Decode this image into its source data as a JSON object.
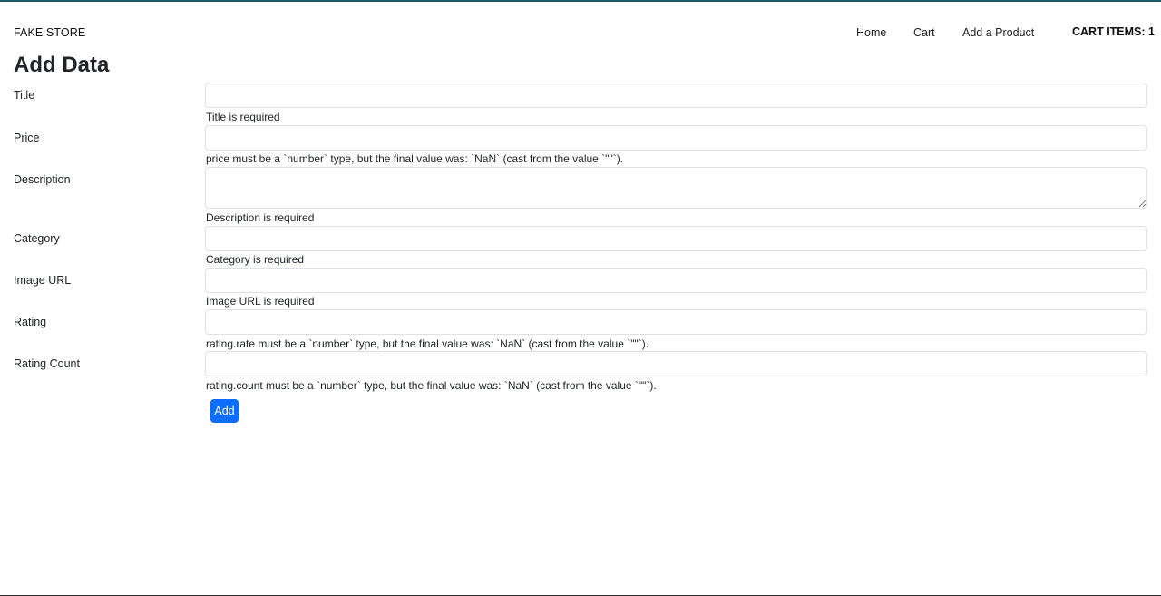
{
  "navbar": {
    "brand": "FAKE STORE",
    "links": [
      "Home",
      "Cart",
      "Add a Product"
    ],
    "cart_items": "CART ITEMS: 1"
  },
  "page": {
    "title": "Add Data"
  },
  "form": {
    "fields": [
      {
        "label": "Title",
        "value": "",
        "error": "Title is required"
      },
      {
        "label": "Price",
        "value": "",
        "error": "price must be a `number` type, but the final value was: `NaN` (cast from the value `\"\"`)."
      },
      {
        "label": "Description",
        "value": "",
        "error": "Description is required"
      },
      {
        "label": "Category",
        "value": "",
        "error": "Category is required"
      },
      {
        "label": "Image URL",
        "value": "",
        "error": "Image URL is required"
      },
      {
        "label": "Rating",
        "value": "",
        "error": "rating.rate must be a `number` type, but the final value was: `NaN` (cast from the value `\"\"`)."
      },
      {
        "label": "Rating Count",
        "value": "",
        "error": "rating.count must be a `number` type, but the final value was: `NaN` (cast from the value `\"\"`)."
      }
    ],
    "submit_label": "Add"
  },
  "colors": {
    "accent": "#0d6efd",
    "top_bar": "#1f5a63"
  }
}
